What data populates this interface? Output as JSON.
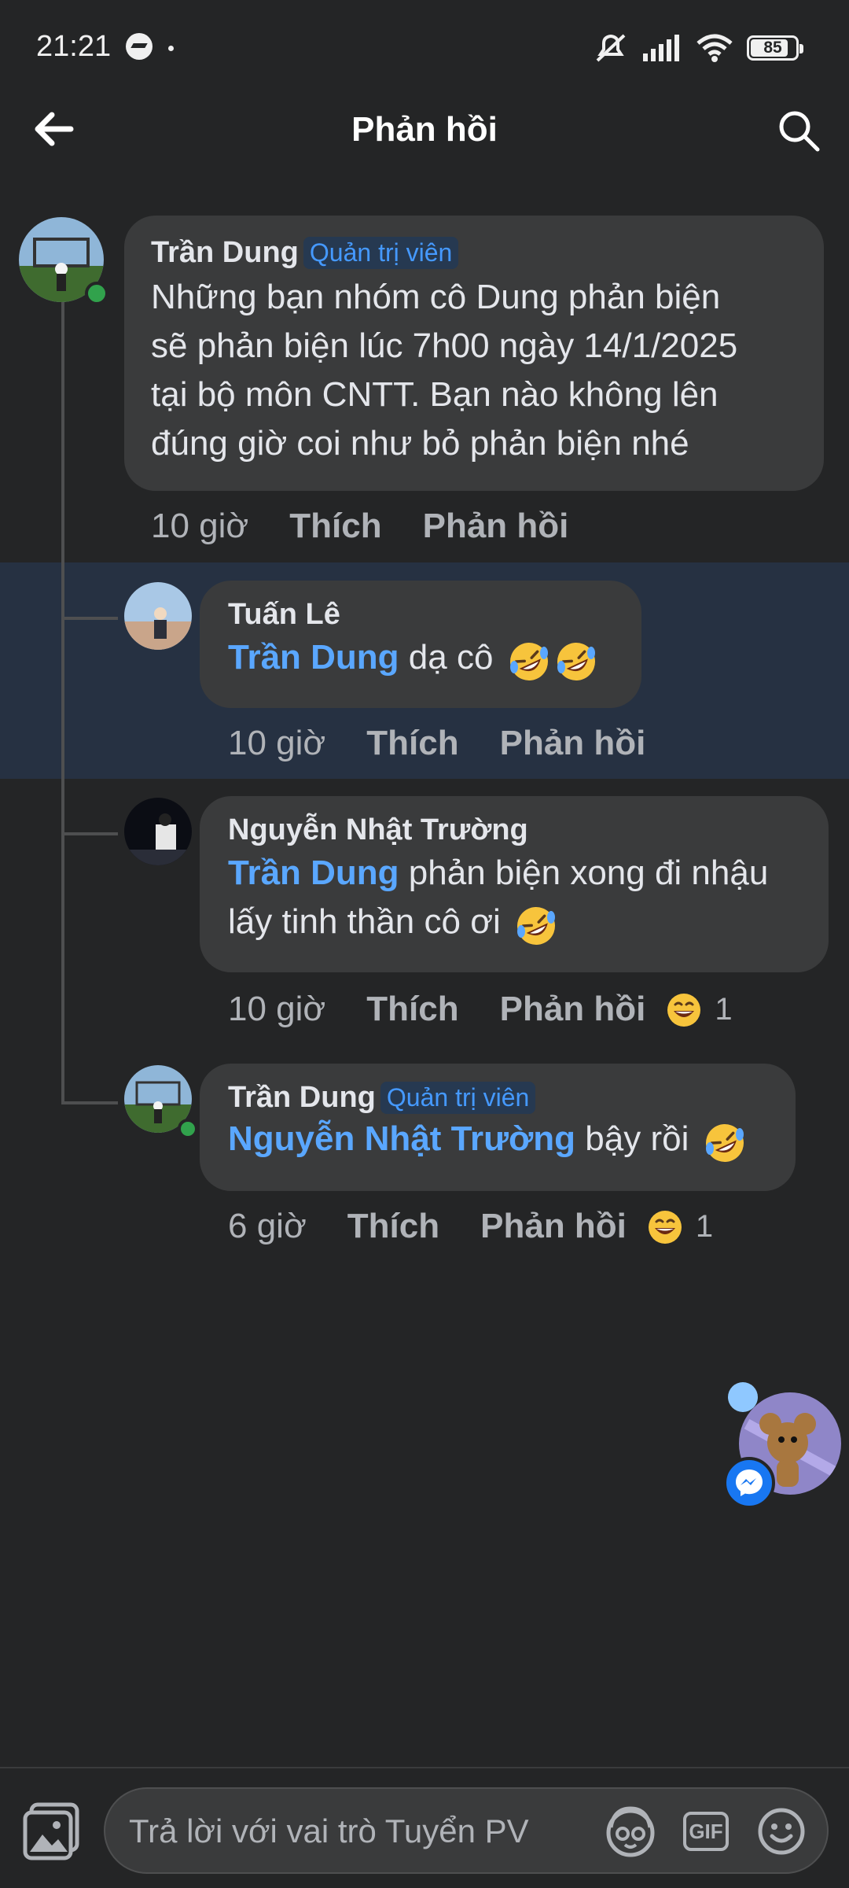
{
  "status_bar": {
    "time": "21:21",
    "battery": "85",
    "battery_level": 0.85,
    "icons": [
      "messenger-icon",
      "mute-icon",
      "signal-icon",
      "wifi-icon",
      "battery-icon"
    ]
  },
  "header": {
    "title": "Phản hồi",
    "back_icon": "arrow-left-icon",
    "search_icon": "search-icon"
  },
  "thread": {
    "main_comment": {
      "author": "Trần Dung",
      "badge": "Quản trị viên",
      "text_lines": [
        "Những bạn nhóm cô Dung phản biện",
        "sẽ phản biện lúc 7h00 ngày 14/1/2025",
        "tại bộ môn CNTT. Bạn nào không lên",
        "đúng giờ coi như bỏ phản biện nhé"
      ],
      "time": "10 giờ",
      "like": "Thích",
      "reply": "Phản hồi"
    },
    "replies": [
      {
        "author": "Tuấn Lê",
        "mention": "Trần Dung",
        "text": "dạ cô",
        "emojis": [
          "rofl",
          "rofl"
        ],
        "time": "10 giờ",
        "like": "Thích",
        "reply": "Phản hồi"
      },
      {
        "author": "Nguyễn Nhật Trường",
        "mention": "Trần Dung",
        "text": "phản biện xong đi nhậu",
        "text2": "lấy tinh thần cô ơi",
        "emojis": [
          "rofl"
        ],
        "time": "10 giờ",
        "like": "Thích",
        "reply": "Phản hồi",
        "reaction": "grin",
        "reaction_count": "1"
      },
      {
        "author": "Trần Dung",
        "badge": "Quản trị viên",
        "mention": "Nguyễn Nhật Trường",
        "text": "bậy rồi",
        "emojis": [
          "rofl"
        ],
        "time": "6 giờ",
        "like": "Thích",
        "reply": "Phản hồi",
        "reaction": "grin",
        "reaction_count": "1"
      }
    ]
  },
  "composer": {
    "placeholder": "Trả lời với vai trò Tuyển PV",
    "gif_label": "GIF",
    "icons": [
      "photo-icon",
      "avatar-sticker-icon",
      "gif-icon",
      "emoji-icon"
    ]
  },
  "colors": {
    "background": "#242526",
    "bubble": "#3a3b3c",
    "mention": "#5aa7ff",
    "badge_text": "#4599ff",
    "online": "#31a24c",
    "highlight": "#263142"
  }
}
